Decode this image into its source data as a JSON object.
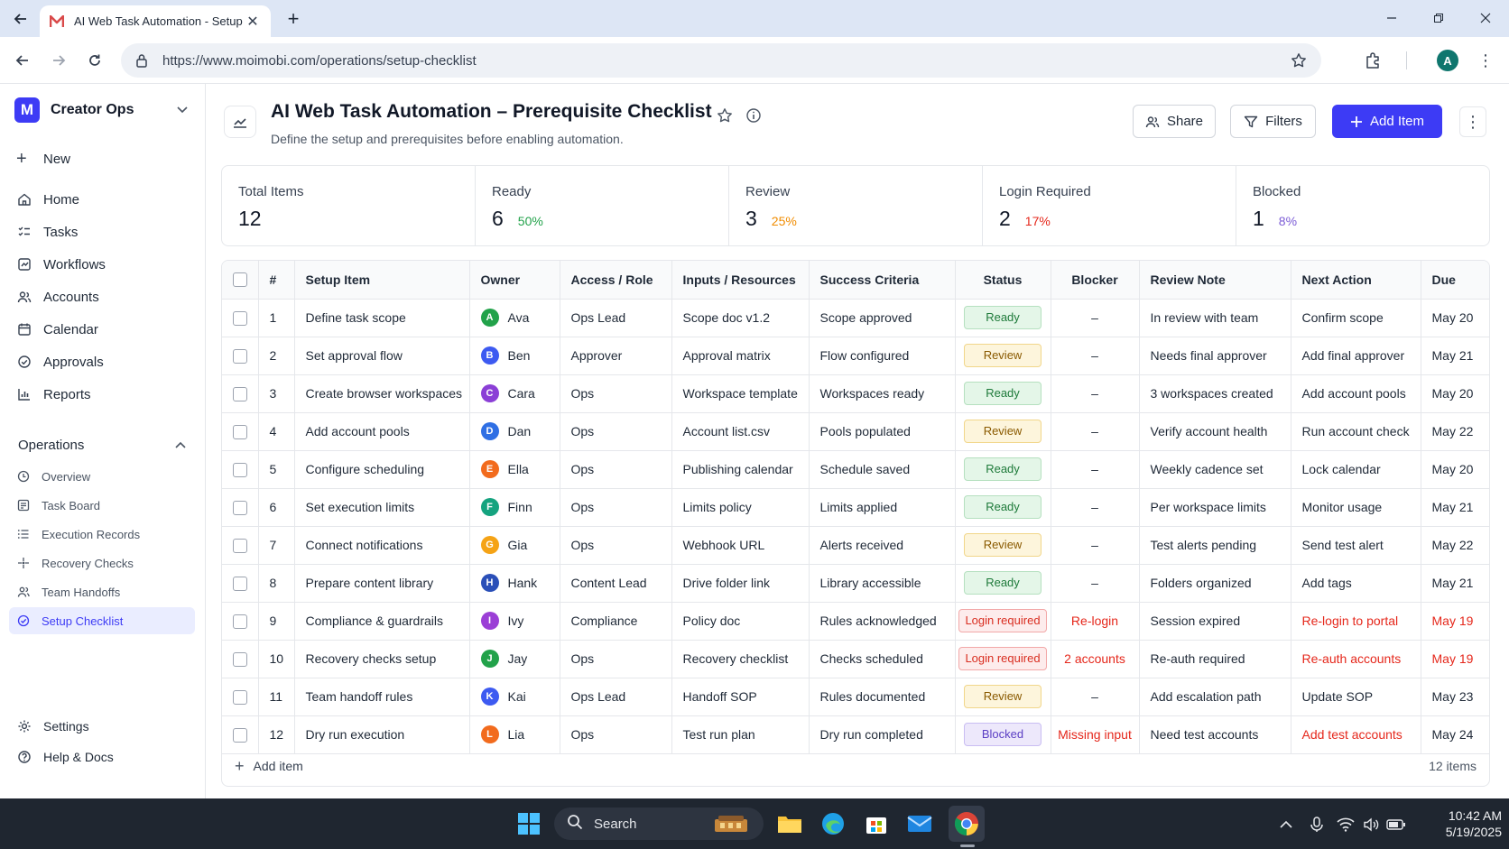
{
  "browser": {
    "tab_title": "AI Web Task Automation - Setup",
    "url": "https://www.moimobi.com/operations/setup-checklist"
  },
  "sidebar": {
    "workspace": "Creator Ops",
    "workspace_initial": "M",
    "new_label": "New",
    "nav": [
      {
        "label": "Home",
        "icon": "home-icon"
      },
      {
        "label": "Tasks",
        "icon": "tasks-icon"
      },
      {
        "label": "Workflows",
        "icon": "workflows-icon"
      },
      {
        "label": "Accounts",
        "icon": "accounts-icon"
      },
      {
        "label": "Calendar",
        "icon": "calendar-icon"
      },
      {
        "label": "Approvals",
        "icon": "approvals-icon"
      },
      {
        "label": "Reports",
        "icon": "reports-icon"
      }
    ],
    "section": "Operations",
    "sub": [
      {
        "label": "Overview",
        "icon": "overview-icon"
      },
      {
        "label": "Task Board",
        "icon": "task-board-icon"
      },
      {
        "label": "Execution Records",
        "icon": "list-icon"
      },
      {
        "label": "Recovery Checks",
        "icon": "recovery-icon"
      },
      {
        "label": "Team Handoffs",
        "icon": "team-icon"
      },
      {
        "label": "Setup Checklist",
        "icon": "checklist-icon"
      }
    ],
    "settings": "Settings",
    "help": "Help & Docs"
  },
  "page": {
    "title": "AI Web Task Automation – Prerequisite Checklist",
    "subtitle": "Define the setup and prerequisites before enabling automation.",
    "share": "Share",
    "filters": "Filters",
    "add_item": "Add Item"
  },
  "stats": [
    {
      "label": "Total Items",
      "value": "12",
      "pct": "",
      "color": "#111827"
    },
    {
      "label": "Ready",
      "value": "6",
      "pct": "50%",
      "color": "#22a24a"
    },
    {
      "label": "Review",
      "value": "3",
      "pct": "25%",
      "color": "#f08c00"
    },
    {
      "label": "Login Required",
      "value": "2",
      "pct": "17%",
      "color": "#e5271b"
    },
    {
      "label": "Blocked",
      "value": "1",
      "pct": "8%",
      "color": "#7c5cd6"
    }
  ],
  "table": {
    "columns": [
      "#",
      "Setup Item",
      "Owner",
      "Access / Role",
      "Inputs / Resources",
      "Success Criteria",
      "Status",
      "Blocker",
      "Review Note",
      "Next Action",
      "Due"
    ],
    "rows": [
      {
        "n": "1",
        "item": "Define task scope",
        "owner": "Ava",
        "initial": "A",
        "avatar": "#22a24a",
        "role": "Ops Lead",
        "inputs": "Scope doc v1.2",
        "criteria": "Scope approved",
        "status": "Ready",
        "kind": "ready",
        "blocker": "–",
        "note": "In review with team",
        "next": "Confirm scope",
        "due": "May 20"
      },
      {
        "n": "2",
        "item": "Set approval flow",
        "owner": "Ben",
        "initial": "B",
        "avatar": "#3d5af1",
        "role": "Approver",
        "inputs": "Approval matrix",
        "criteria": "Flow configured",
        "status": "Review",
        "kind": "review",
        "blocker": "–",
        "note": "Needs final approver",
        "next": "Add final approver",
        "due": "May 21"
      },
      {
        "n": "3",
        "item": "Create browser workspaces",
        "owner": "Cara",
        "initial": "C",
        "avatar": "#8b3fd6",
        "role": "Ops",
        "inputs": "Workspace template",
        "criteria": "Workspaces ready",
        "status": "Ready",
        "kind": "ready",
        "blocker": "–",
        "note": "3 workspaces created",
        "next": "Add account pools",
        "due": "May 20"
      },
      {
        "n": "4",
        "item": "Add account pools",
        "owner": "Dan",
        "initial": "D",
        "avatar": "#2f6fe4",
        "role": "Ops",
        "inputs": "Account list.csv",
        "criteria": "Pools populated",
        "status": "Review",
        "kind": "review",
        "blocker": "–",
        "note": "Verify account health",
        "next": "Run account check",
        "due": "May 22"
      },
      {
        "n": "5",
        "item": "Configure scheduling",
        "owner": "Ella",
        "initial": "E",
        "avatar": "#f26b1d",
        "role": "Ops",
        "inputs": "Publishing calendar",
        "criteria": "Schedule saved",
        "status": "Ready",
        "kind": "ready",
        "blocker": "–",
        "note": "Weekly cadence set",
        "next": "Lock calendar",
        "due": "May 20"
      },
      {
        "n": "6",
        "item": "Set execution limits",
        "owner": "Finn",
        "initial": "F",
        "avatar": "#15a37f",
        "role": "Ops",
        "inputs": "Limits policy",
        "criteria": "Limits applied",
        "status": "Ready",
        "kind": "ready",
        "blocker": "–",
        "note": "Per workspace limits",
        "next": "Monitor usage",
        "due": "May 21"
      },
      {
        "n": "7",
        "item": "Connect notifications",
        "owner": "Gia",
        "initial": "G",
        "avatar": "#f5a316",
        "role": "Ops",
        "inputs": "Webhook URL",
        "criteria": "Alerts received",
        "status": "Review",
        "kind": "review",
        "blocker": "–",
        "note": "Test alerts pending",
        "next": "Send test alert",
        "due": "May 22"
      },
      {
        "n": "8",
        "item": "Prepare content library",
        "owner": "Hank",
        "initial": "H",
        "avatar": "#2a4fb8",
        "role": "Content Lead",
        "inputs": "Drive folder link",
        "criteria": "Library accessible",
        "status": "Ready",
        "kind": "ready",
        "blocker": "–",
        "note": "Folders organized",
        "next": "Add tags",
        "due": "May 21"
      },
      {
        "n": "9",
        "item": "Compliance & guardrails",
        "owner": "Ivy",
        "initial": "I",
        "avatar": "#9b3fd6",
        "role": "Compliance",
        "inputs": "Policy doc",
        "criteria": "Rules acknowledged",
        "status": "Login required",
        "kind": "login",
        "blocker": "Re-login",
        "note": "Session expired",
        "next": "Re-login to portal",
        "due": "May 19"
      },
      {
        "n": "10",
        "item": "Recovery checks setup",
        "owner": "Jay",
        "initial": "J",
        "avatar": "#22a24a",
        "role": "Ops",
        "inputs": "Recovery checklist",
        "criteria": "Checks scheduled",
        "status": "Login required",
        "kind": "login",
        "blocker": "2 accounts",
        "note": "Re-auth required",
        "next": "Re-auth accounts",
        "due": "May 19"
      },
      {
        "n": "11",
        "item": "Team handoff rules",
        "owner": "Kai",
        "initial": "K",
        "avatar": "#3d5af1",
        "role": "Ops Lead",
        "inputs": "Handoff SOP",
        "criteria": "Rules documented",
        "status": "Review",
        "kind": "review",
        "blocker": "–",
        "note": "Add escalation path",
        "next": "Update SOP",
        "due": "May 23"
      },
      {
        "n": "12",
        "item": "Dry run execution",
        "owner": "Lia",
        "initial": "L",
        "avatar": "#f26b1d",
        "role": "Ops",
        "inputs": "Test run plan",
        "criteria": "Dry run completed",
        "status": "Blocked",
        "kind": "blocked",
        "blocker": "Missing input",
        "note": "Need test accounts",
        "next": "Add test accounts",
        "due": "May 24"
      }
    ],
    "add_row": "Add item",
    "count": "12 items"
  },
  "taskbar": {
    "search": "Search",
    "time": "10:42 AM",
    "date": "5/19/2025"
  }
}
